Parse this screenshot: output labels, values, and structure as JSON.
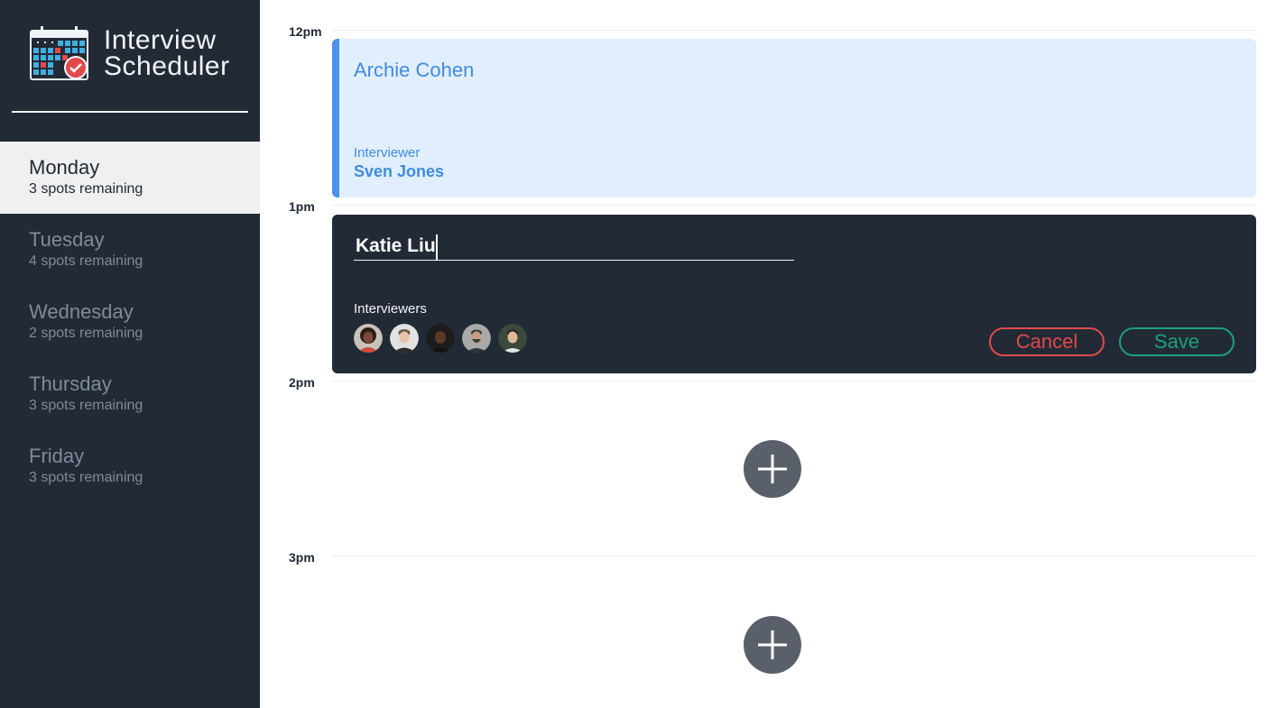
{
  "app": {
    "title_line1": "Interview",
    "title_line2": "Scheduler"
  },
  "days": [
    {
      "name": "Monday",
      "spots": "3 spots remaining",
      "selected": true
    },
    {
      "name": "Tuesday",
      "spots": "4 spots remaining",
      "selected": false
    },
    {
      "name": "Wednesday",
      "spots": "2 spots remaining",
      "selected": false
    },
    {
      "name": "Thursday",
      "spots": "3 spots remaining",
      "selected": false
    },
    {
      "name": "Friday",
      "spots": "3 spots remaining",
      "selected": false
    }
  ],
  "times": [
    "12pm",
    "1pm",
    "2pm",
    "3pm"
  ],
  "appointment_show": {
    "student": "Archie Cohen",
    "interviewer_label": "Interviewer",
    "interviewer_name": "Sven Jones"
  },
  "appointment_form": {
    "student_value": "Katie Liu",
    "interviewers_label": "Interviewers",
    "interviewers": [
      {
        "icon": "avatar-woman-curly"
      },
      {
        "icon": "avatar-man-light"
      },
      {
        "icon": "avatar-man-dark"
      },
      {
        "icon": "avatar-man-beard"
      },
      {
        "icon": "avatar-man-smiling"
      }
    ],
    "cancel_label": "Cancel",
    "save_label": "Save"
  },
  "colors": {
    "sidebar_bg": "#222a36",
    "selected_day_bg": "#f0f0f0",
    "appointment_accent": "#4a92ec",
    "appointment_bg": "#e1eefd",
    "danger": "#e04a4a",
    "success": "#1ba279",
    "add_button": "#5a6069"
  }
}
